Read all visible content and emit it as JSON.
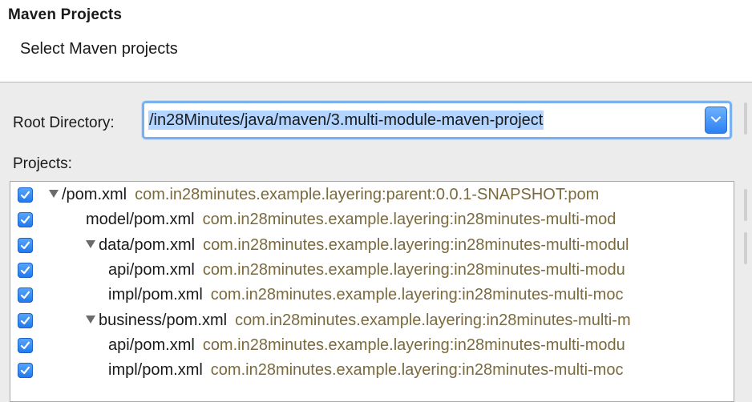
{
  "header": {
    "title": "Maven Projects",
    "subtitle": "Select Maven projects"
  },
  "root_directory": {
    "label": "Root Directory:",
    "value": "/in28Minutes/java/maven/3.multi-module-maven-project"
  },
  "projects": {
    "label": "Projects:",
    "rows": [
      {
        "name": "/pom.xml",
        "artifact": "com.in28minutes.example.layering:parent:0.0.1-SNAPSHOT:pom",
        "checked": true,
        "expandable": true,
        "depth": 0
      },
      {
        "name": "model/pom.xml",
        "artifact": "com.in28minutes.example.layering:in28minutes-multi-mod",
        "checked": true,
        "expandable": false,
        "depth": 1
      },
      {
        "name": "data/pom.xml",
        "artifact": "com.in28minutes.example.layering:in28minutes-multi-modul",
        "checked": true,
        "expandable": true,
        "depth": 1
      },
      {
        "name": "api/pom.xml",
        "artifact": "com.in28minutes.example.layering:in28minutes-multi-modu",
        "checked": true,
        "expandable": false,
        "depth": 2
      },
      {
        "name": "impl/pom.xml",
        "artifact": "com.in28minutes.example.layering:in28minutes-multi-moc",
        "checked": true,
        "expandable": false,
        "depth": 2
      },
      {
        "name": "business/pom.xml",
        "artifact": "com.in28minutes.example.layering:in28minutes-multi-m",
        "checked": true,
        "expandable": true,
        "depth": 1
      },
      {
        "name": "api/pom.xml",
        "artifact": "com.in28minutes.example.layering:in28minutes-multi-modu",
        "checked": true,
        "expandable": false,
        "depth": 2
      },
      {
        "name": "impl/pom.xml",
        "artifact": "com.in28minutes.example.layering:in28minutes-multi-moc",
        "checked": true,
        "expandable": false,
        "depth": 2
      }
    ]
  },
  "colors": {
    "accent": "#2a7ff3",
    "focus_ring": "#7ab0ee",
    "selection": "#b3d5ff",
    "artifact_text": "#7a6a3e"
  },
  "icons": {
    "checkbox": "check-icon",
    "expanded": "triangle-down-icon",
    "combo": "chevron-down-icon"
  }
}
